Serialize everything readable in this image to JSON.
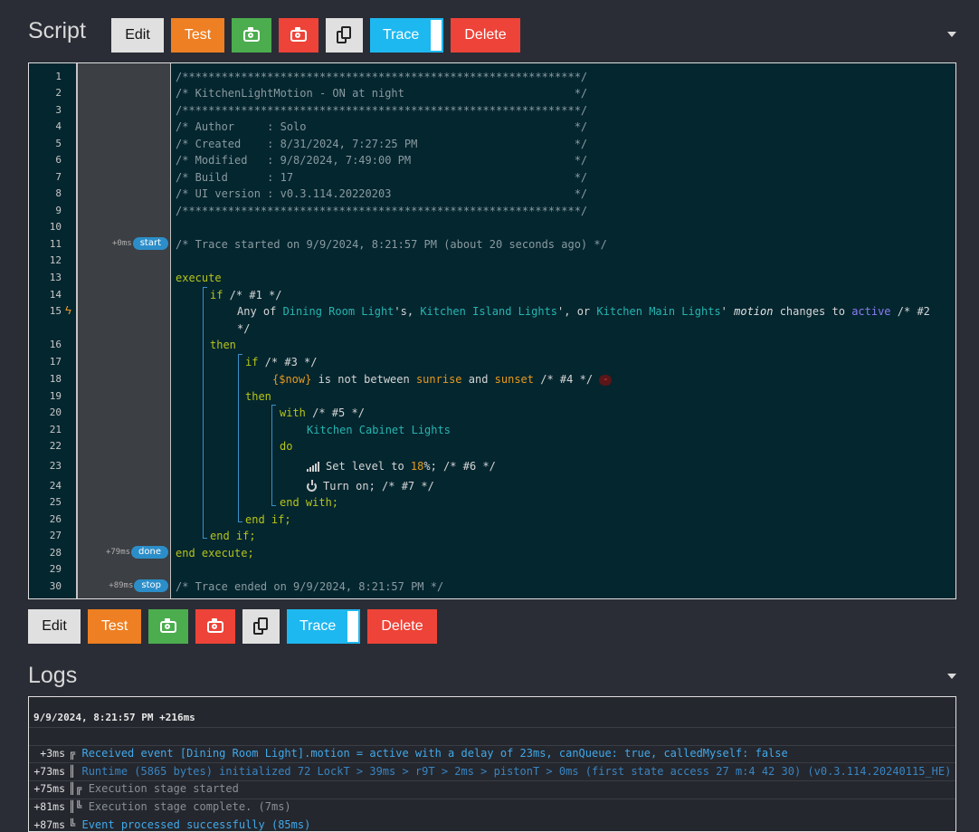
{
  "script_section": {
    "title": "Script"
  },
  "toolbar": {
    "edit": "Edit",
    "test": "Test",
    "trace": "Trace",
    "delete": "Delete",
    "icons": [
      "camera-icon",
      "camera-icon",
      "copy-icon"
    ]
  },
  "code_lines": [
    {
      "n": "1",
      "text": "/*************************************************************/"
    },
    {
      "n": "2",
      "text": "/* KitchenLightMotion - ON at night                          */"
    },
    {
      "n": "3",
      "text": "/*************************************************************/"
    },
    {
      "n": "4",
      "text": "/* Author     : Solo                                         */"
    },
    {
      "n": "5",
      "text": "/* Created    : 8/31/2024, 7:27:25 PM                        */"
    },
    {
      "n": "6",
      "text": "/* Modified   : 9/8/2024, 7:49:00 PM                         */"
    },
    {
      "n": "7",
      "text": "/* Build      : 17                                           */"
    },
    {
      "n": "8",
      "text": "/* UI version : v0.3.114.20220203                            */"
    },
    {
      "n": "9",
      "text": "/*************************************************************/"
    },
    {
      "n": "10",
      "text": ""
    },
    {
      "n": "11",
      "text": "/* Trace started on 9/9/2024, 8:21:57 PM (about 20 seconds ago) */"
    },
    {
      "n": "12",
      "text": ""
    },
    {
      "n": "13",
      "text": "execute"
    },
    {
      "n": "14",
      "text": "if /* #1 */"
    },
    {
      "n": "15",
      "text": "Any of Dining Room Light's, Kitchen Island Lights', or Kitchen Main Lights' motion changes to active /* #2"
    },
    {
      "n": "16",
      "text": "then"
    },
    {
      "n": "17",
      "text": "if /* #3 */"
    },
    {
      "n": "18",
      "text": "{$now} is not between sunrise and sunset /* #4 */"
    },
    {
      "n": "19",
      "text": "then"
    },
    {
      "n": "20",
      "text": "with /* #5 */"
    },
    {
      "n": "21",
      "text": "Kitchen Cabinet Lights"
    },
    {
      "n": "22",
      "text": "do"
    },
    {
      "n": "23",
      "text": "Set level to 18%; /* #6 */"
    },
    {
      "n": "24",
      "text": "Turn on; /* #7 */"
    },
    {
      "n": "25",
      "text": "end with;"
    },
    {
      "n": "26",
      "text": "end if;"
    },
    {
      "n": "27",
      "text": "end if;"
    },
    {
      "n": "28",
      "text": "end execute;"
    },
    {
      "n": "29",
      "text": ""
    },
    {
      "n": "30",
      "text": "/* Trace ended on 9/9/2024, 8:21:57 PM */"
    }
  ],
  "code_extra": {
    "line15_wrap": "*/",
    "minus": "-"
  },
  "code_parts": {
    "any_of": "Any of ",
    "dev1": "Dining Room Light",
    "sep1": "'s, ",
    "dev2": "Kitchen Island Lights",
    "sep2": "', or ",
    "dev3": "Kitchen Main Lights",
    "sep3": "' ",
    "attr": "motion",
    "changes": " changes to ",
    "active": "active",
    "c2": " /* #2",
    "now": "{$now}",
    "between": " is not between ",
    "sunrise": "sunrise",
    "and": " and ",
    "sunset": "sunset",
    "c4": " /* #4 */",
    "if": "if",
    "c1": " /* #1 */",
    "c3": " /* #3 */",
    "with": "with",
    "c5": " /* #5 */",
    "device": "Kitchen Cabinet Lights",
    "do": "do",
    "setlevel": "Set level to ",
    "pct": "18",
    "pctsign": "%; /* #6 */",
    "turnon": "Turn on; /* #7 */",
    "then": "then",
    "endwith": "end with;",
    "endif": "end if;",
    "execute": "execute",
    "endexecute": "end execute;"
  },
  "trace_badges": [
    {
      "line": "11",
      "time": "+0ms",
      "label": "start"
    },
    {
      "line": "28",
      "time": "+79ms",
      "label": "done"
    },
    {
      "line": "30",
      "time": "+89ms",
      "label": "stop"
    }
  ],
  "logs_section": {
    "title": "Logs"
  },
  "logs": {
    "header": "9/9/2024, 8:21:57 PM +216ms",
    "entries": [
      {
        "time": "+3ms",
        "prefix": "╔",
        "text": "Received event [Dining Room Light].motion = active with a delay of 23ms, canQueue: true, calledMyself: false"
      },
      {
        "time": "+73ms",
        "prefix": "║",
        "text": "Runtime (5865 bytes) initialized 72 LockT > 39ms > r9T > 2ms > pistonT > 0ms (first state access 27 m:4 42 30) (v0.3.114.20240115_HE)"
      },
      {
        "time": "+75ms",
        "prefix": "║╔",
        "text": "Execution stage started"
      },
      {
        "time": "+81ms",
        "prefix": "║╚",
        "text": "Execution stage complete. (7ms)"
      },
      {
        "time": "+87ms",
        "prefix": "╚",
        "text": "Event processed successfully (85ms)"
      }
    ]
  }
}
